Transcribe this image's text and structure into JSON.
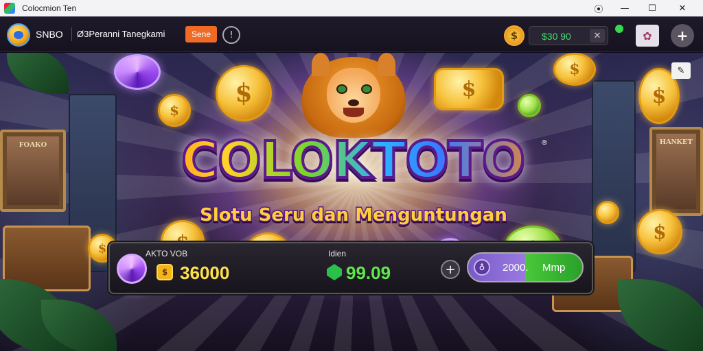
{
  "window": {
    "title": "Colocmion Ten",
    "controls": {
      "record": "⦿",
      "minimize": "—",
      "maximize": "☐",
      "close": "✕"
    }
  },
  "topbar": {
    "brand": "SNBO",
    "tagline": "Ø3Peranni Tanegkami",
    "orange_button": "Sene",
    "info_icon": "!",
    "balance": "$30 90",
    "balance_close": "✕",
    "coin_symbol": "$",
    "avatar_icon": "✿",
    "plus": "+"
  },
  "game": {
    "title": "COLOKTOTO",
    "title_mark": "®",
    "subtitle": "Slotu Seru dan Menguntungan",
    "frame_left_label": "FOAKO",
    "frame_right_label": "HANKET",
    "corner_icon": "✎"
  },
  "panel": {
    "label_left": "AKTO VOB",
    "coins_value": "36000",
    "coin_symbol": "$",
    "label_mid": "Idien",
    "gems_value": "99.09",
    "add": "+",
    "spin_amount": "2000.",
    "spin_label": "Mmp",
    "spin_icon": "♁"
  },
  "colors": {
    "accent_orange": "#ef6a25",
    "balance_green": "#3de06a",
    "coins_yellow": "#ffe04a",
    "gems_green": "#5fe84a"
  }
}
